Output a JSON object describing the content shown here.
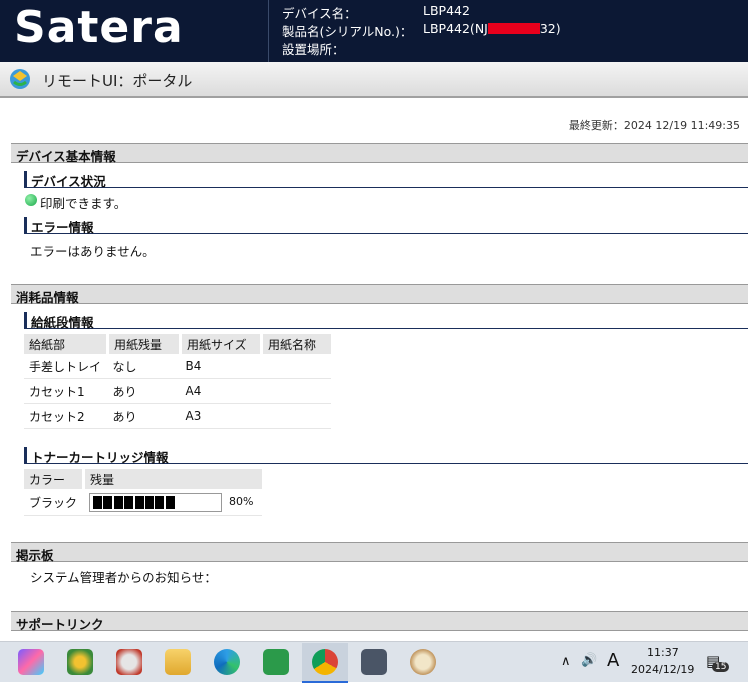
{
  "header": {
    "logo": "Satera",
    "device_name_label": "デバイス名：",
    "device_name": "LBP442",
    "product_label": "製品名(シリアルNo.)：",
    "product_prefix": "LBP442(NJ",
    "product_suffix": "32)",
    "location_label": "設置場所："
  },
  "titlebar": {
    "title": "リモートUI：ポータル"
  },
  "last_updated": "最終更新：2024 12/19 11:49:35",
  "device_info": {
    "section": "デバイス基本情報",
    "status_heading": "デバイス状況",
    "status_text": "印刷できます。",
    "status_color": "#1aa84a",
    "error_heading": "エラー情報",
    "error_text": "エラーはありません。"
  },
  "consumables": {
    "section": "消耗品情報",
    "paper_heading": "給紙段情報",
    "paper_columns": [
      "給紙部",
      "用紙残量",
      "用紙サイズ",
      "用紙名称"
    ],
    "paper_rows": [
      [
        "手差しトレイ",
        "なし",
        "B4",
        ""
      ],
      [
        "カセット1",
        "あり",
        "A4",
        ""
      ],
      [
        "カセット2",
        "あり",
        "A3",
        ""
      ]
    ],
    "toner_heading": "トナーカートリッジ情報",
    "toner_columns": [
      "カラー",
      "残量"
    ],
    "toner_color": "ブラック",
    "toner_level_percent": 80,
    "toner_level_text": "80%"
  },
  "board": {
    "section": "掲示板",
    "text": "システム管理者からのお知らせ："
  },
  "support": {
    "section": "サポートリンク"
  },
  "taskbar": {
    "icons": [
      "copilot-icon",
      "app-icon",
      "paint-icon",
      "file-explorer-icon",
      "edge-icon",
      "spreadsheet-icon",
      "chrome-icon",
      "calculator-icon",
      "paint-palette-icon"
    ],
    "ime": "A",
    "time": "11:37",
    "date": "2024/12/19",
    "notifications": "15"
  }
}
